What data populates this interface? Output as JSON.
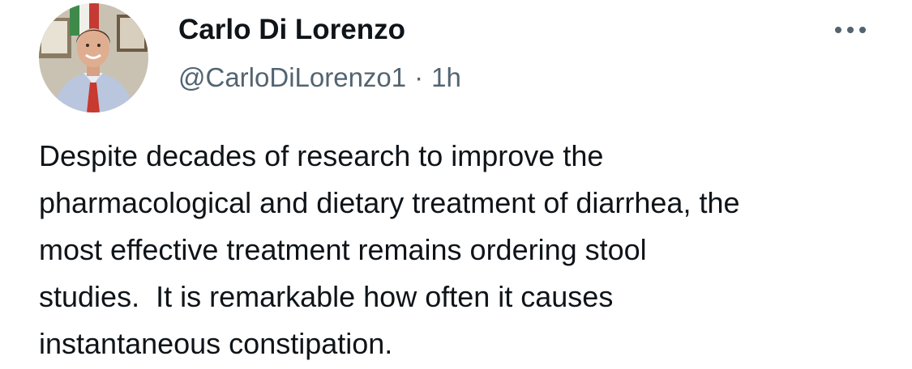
{
  "author": {
    "display_name": "Carlo Di Lorenzo",
    "handle": "@CarloDiLorenzo1",
    "separator": "·",
    "timestamp": "1h"
  },
  "tweet": {
    "lines": [
      "Despite decades of research to improve the",
      "pharmacological and dietary treatment of diarrhea, the",
      "most effective treatment remains ordering stool",
      "studies.  It is remarkable how often it causes",
      "instantaneous constipation."
    ]
  },
  "icons": {
    "avatar": "avatar-photo",
    "more": "more-options-icon"
  },
  "colors": {
    "text": "#0f1419",
    "secondary": "#536471",
    "background": "#ffffff"
  }
}
